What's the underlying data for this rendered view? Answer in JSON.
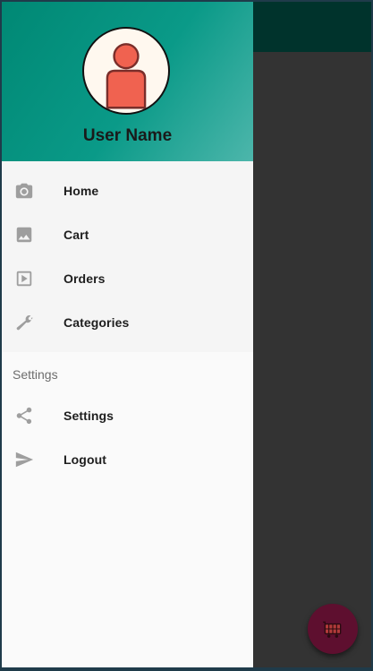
{
  "drawer": {
    "header": {
      "user_name": "User Name",
      "avatar_icon": "user-avatar-icon"
    },
    "main_items": [
      {
        "label": "Home",
        "icon": "camera-icon"
      },
      {
        "label": "Cart",
        "icon": "image-icon"
      },
      {
        "label": "Orders",
        "icon": "play-box-icon"
      },
      {
        "label": "Categories",
        "icon": "wrench-icon"
      }
    ],
    "section_label": "Settings",
    "secondary_items": [
      {
        "label": "Settings",
        "icon": "share-icon"
      },
      {
        "label": "Logout",
        "icon": "send-icon"
      }
    ]
  },
  "fab": {
    "icon": "shopping-cart-icon"
  },
  "colors": {
    "header_gradient_start": "#008874",
    "header_gradient_end": "#4db6ab",
    "app_bar": "#00332c",
    "fab": "#5e0f2f",
    "icon_gray": "#9e9e9e"
  }
}
